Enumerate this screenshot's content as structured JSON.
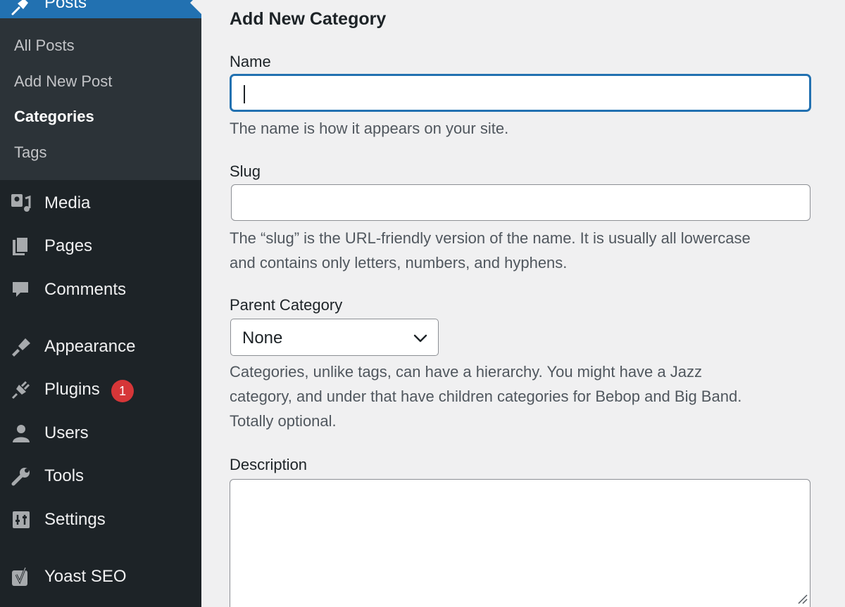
{
  "sidebar": {
    "posts_label": "Posts",
    "submenu": [
      {
        "label": "All Posts",
        "current": false
      },
      {
        "label": "Add New Post",
        "current": false
      },
      {
        "label": "Categories",
        "current": true
      },
      {
        "label": "Tags",
        "current": false
      }
    ],
    "items": [
      {
        "label": "Media",
        "icon": "media-icon"
      },
      {
        "label": "Pages",
        "icon": "pages-icon"
      },
      {
        "label": "Comments",
        "icon": "comments-icon"
      },
      {
        "label": "Appearance",
        "icon": "appearance-icon"
      },
      {
        "label": "Plugins",
        "icon": "plugins-icon",
        "badge": "1"
      },
      {
        "label": "Users",
        "icon": "users-icon"
      },
      {
        "label": "Tools",
        "icon": "tools-icon"
      },
      {
        "label": "Settings",
        "icon": "settings-icon"
      },
      {
        "label": "Yoast SEO",
        "icon": "yoast-icon"
      }
    ]
  },
  "form": {
    "title": "Add New Category",
    "name": {
      "label": "Name",
      "value": "",
      "help": "The name is how it appears on your site."
    },
    "slug": {
      "label": "Slug",
      "value": "",
      "help_line1": "The “slug” is the URL-friendly version of the name. It is usually all lowercase",
      "help_line2": "and contains only letters, numbers, and hyphens."
    },
    "parent": {
      "label": "Parent Category",
      "selected": "None",
      "help_line1": "Categories, unlike tags, can have a hierarchy. You might have a Jazz",
      "help_line2": "category, and under that have children categories for Bebop and Big Band.",
      "help_line3": "Totally optional."
    },
    "description": {
      "label": "Description",
      "value": ""
    }
  },
  "colors": {
    "sidebar_bg": "#1d2327",
    "submenu_bg": "#2c3338",
    "accent": "#2271b1",
    "badge": "#d63638",
    "page_bg": "#f0f0f1"
  }
}
